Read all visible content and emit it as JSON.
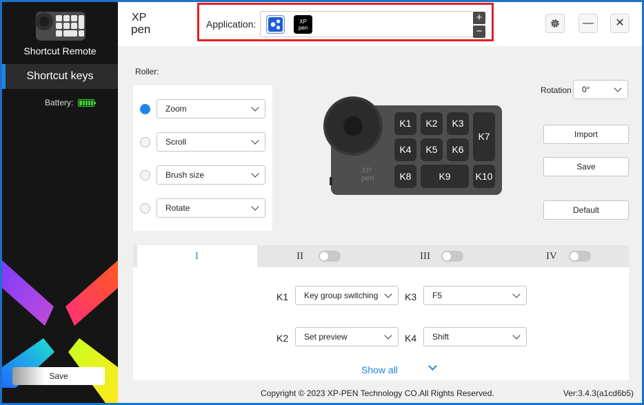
{
  "sidebar": {
    "device_name": "Shortcut Remote",
    "nav_label": "Shortcut keys",
    "battery_label": "Battery:",
    "battery_level": 1.0,
    "save_label": "Save"
  },
  "header": {
    "logo_line1": "XP",
    "logo_line2": "pen",
    "application_label": "Application:",
    "app_icon_2_text": "XP pen",
    "add_symbol": "+",
    "remove_symbol": "−",
    "settings_icon": "gear-icon",
    "minimize_symbol": "—",
    "close_symbol": "✕"
  },
  "roller": {
    "label": "Roller:",
    "options": [
      {
        "value": "Zoom",
        "selected": true
      },
      {
        "value": "Scroll",
        "selected": false
      },
      {
        "value": "Brush size",
        "selected": false
      },
      {
        "value": "Rotate",
        "selected": false
      }
    ]
  },
  "remote": {
    "keys": [
      "K1",
      "K2",
      "K3",
      "K4",
      "K5",
      "K6",
      "K7",
      "K8",
      "K9",
      "K10"
    ],
    "brand_line1": "XP",
    "brand_line2": "pen"
  },
  "rotation": {
    "label": "Rotation",
    "value": "0°"
  },
  "actions": {
    "import_label": "Import",
    "save_label": "Save",
    "default_label": "Default"
  },
  "tabs": [
    {
      "label": "I",
      "active": true
    },
    {
      "label": "II",
      "active": false
    },
    {
      "label": "III",
      "active": false
    },
    {
      "label": "IV",
      "active": false
    }
  ],
  "key_assignments": [
    {
      "key": "K1",
      "value": "Key group switching"
    },
    {
      "key": "K3",
      "value": "F5"
    },
    {
      "key": "K2",
      "value": "Set preview"
    },
    {
      "key": "K4",
      "value": "Shift"
    }
  ],
  "show_all_label": "Show all",
  "footer": {
    "copyright": "Copyright © 2023  XP-PEN Technology CO.All Rights Reserved.",
    "version": "Ver:3.4.3(a1cd6b5)"
  },
  "colors": {
    "accent": "#1f86e6",
    "highlight_border": "#e02020",
    "sidebar_bg": "#151515",
    "battery": "#38d830"
  }
}
